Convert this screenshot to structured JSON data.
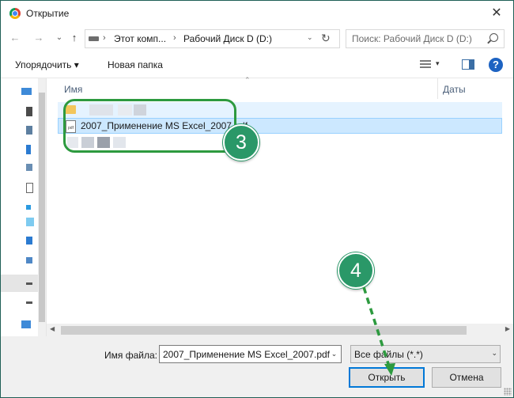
{
  "window": {
    "title": "Открытие",
    "close_glyph": "✕",
    "app_icon": "chrome-icon"
  },
  "nav": {
    "back_glyph": "←",
    "forward_glyph": "→",
    "recent_glyph": "⌄",
    "up_glyph": "↑",
    "address": {
      "segments": [
        "Этот комп...",
        "Рабочий Диск D (D:)"
      ],
      "separator": "›",
      "dropdown_glyph": "⌄",
      "refresh_glyph": "↻"
    },
    "search_placeholder": "Поиск: Рабочий Диск D (D:)"
  },
  "toolbar": {
    "organize_label": "Упорядочить ▾",
    "new_folder_label": "Новая папка",
    "view_dd_glyph": "▾",
    "help_glyph": "?"
  },
  "columns": {
    "name": "Имя",
    "date": "Даты",
    "sort_glyph": "⌃"
  },
  "files": [
    {
      "type": "folder",
      "name": ""
    },
    {
      "type": "pdf",
      "name": "2007_Применение MS Excel_2007.pdf",
      "icon_label": "pdf",
      "selected": true
    }
  ],
  "scroll": {
    "left_glyph": "◀",
    "right_glyph": "▶"
  },
  "callouts": {
    "step3": "3",
    "step4": "4",
    "highlight_color": "#2d9a3f",
    "badge_color": "#2a9868"
  },
  "bottom": {
    "filename_label": "Имя файла:",
    "filename_value": "2007_Применение MS Excel_2007.pdf",
    "filename_dd_glyph": "⌄",
    "filetype_value": "Все файлы (*.*)",
    "filetype_dd_glyph": "⌄",
    "open_label": "Открыть",
    "cancel_label": "Отмена"
  }
}
